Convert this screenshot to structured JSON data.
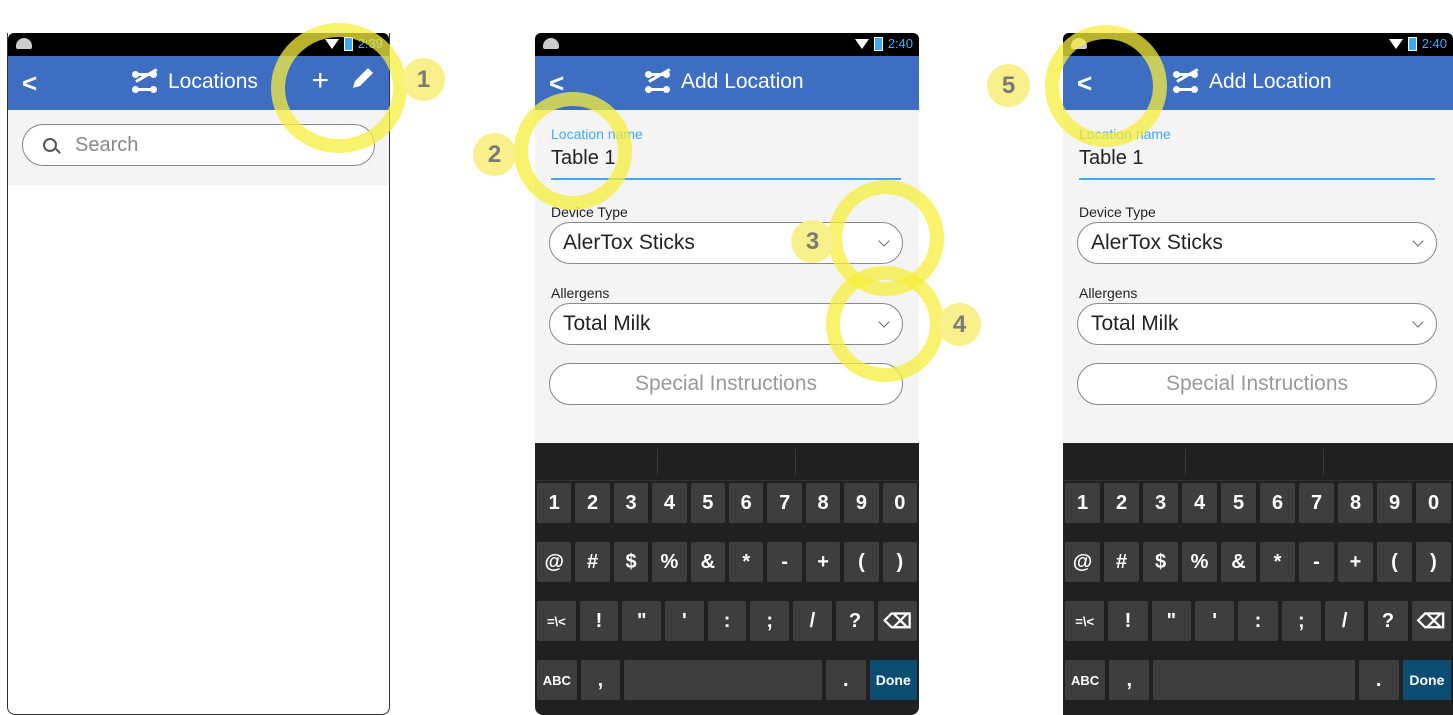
{
  "screen1": {
    "status_time": "2:39",
    "title": "Locations",
    "search_placeholder": "Search",
    "add_icon": "+",
    "edit_icon": "pencil-icon"
  },
  "screen2": {
    "status_time": "2:40",
    "title": "Add Location",
    "location_label": "Location name",
    "location_value": "Table 1",
    "device_label": "Device Type",
    "device_value": "AlerTox Sticks",
    "allergens_label": "Allergens",
    "allergens_value": "Total Milk",
    "special_button": "Special Instructions"
  },
  "screen3": {
    "status_time": "2:40",
    "title": "Add Location",
    "location_label": "Location name",
    "location_value": "Table 1",
    "device_label": "Device Type",
    "device_value": "AlerTox Sticks",
    "allergens_label": "Allergens",
    "allergens_value": "Total Milk",
    "special_button": "Special Instructions"
  },
  "keyboard": {
    "row1": [
      "1",
      "2",
      "3",
      "4",
      "5",
      "6",
      "7",
      "8",
      "9",
      "0"
    ],
    "row2": [
      "@",
      "#",
      "$",
      "%",
      "&",
      "*",
      "-",
      "+",
      "(",
      ")"
    ],
    "row3": [
      "=\\<",
      "!",
      "\"",
      "'",
      ":",
      ";",
      "/",
      "?",
      "⌫"
    ],
    "abc": "ABC",
    "comma": ",",
    "period": ".",
    "done": "Done"
  },
  "callouts": [
    "1",
    "2",
    "3",
    "4",
    "5"
  ],
  "colors": {
    "appbar": "#3d6ec2",
    "accent": "#3fa9f5",
    "highlight": "#f5ee3c"
  }
}
